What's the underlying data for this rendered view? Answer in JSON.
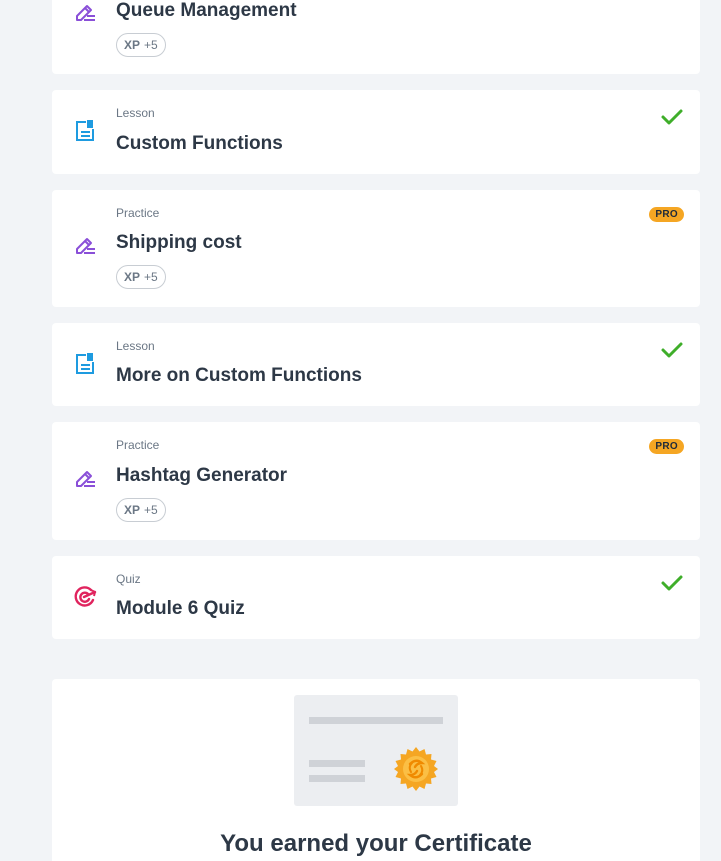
{
  "items": [
    {
      "type": "",
      "title": "Queue Management",
      "xp_label": "XP",
      "xp_value": "+5",
      "icon": "practice-pencil-icon"
    },
    {
      "type": "Lesson",
      "title": "Custom Functions",
      "icon": "lesson-document-icon",
      "status": "completed"
    },
    {
      "type": "Practice",
      "title": "Shipping cost",
      "xp_label": "XP",
      "xp_value": "+5",
      "badge": "PRO",
      "icon": "practice-pencil-icon"
    },
    {
      "type": "Lesson",
      "title": "More on Custom Functions",
      "icon": "lesson-document-icon",
      "status": "completed"
    },
    {
      "type": "Practice",
      "title": "Hashtag Generator",
      "xp_label": "XP",
      "xp_value": "+5",
      "badge": "PRO",
      "icon": "practice-pencil-icon"
    },
    {
      "type": "Quiz",
      "title": "Module 6 Quiz",
      "icon": "quiz-target-icon",
      "status": "completed"
    }
  ],
  "certificate": {
    "title": "You earned your Certificate",
    "icon": "certificate-seal-icon"
  },
  "colors": {
    "background": "#f2f4f7",
    "practice_icon": "#8a4fd8",
    "lesson_icon": "#1e9be0",
    "quiz_icon": "#e0245e",
    "check": "#3fae2a",
    "pro_badge": "#f5a623",
    "seal": "#f5a623"
  }
}
